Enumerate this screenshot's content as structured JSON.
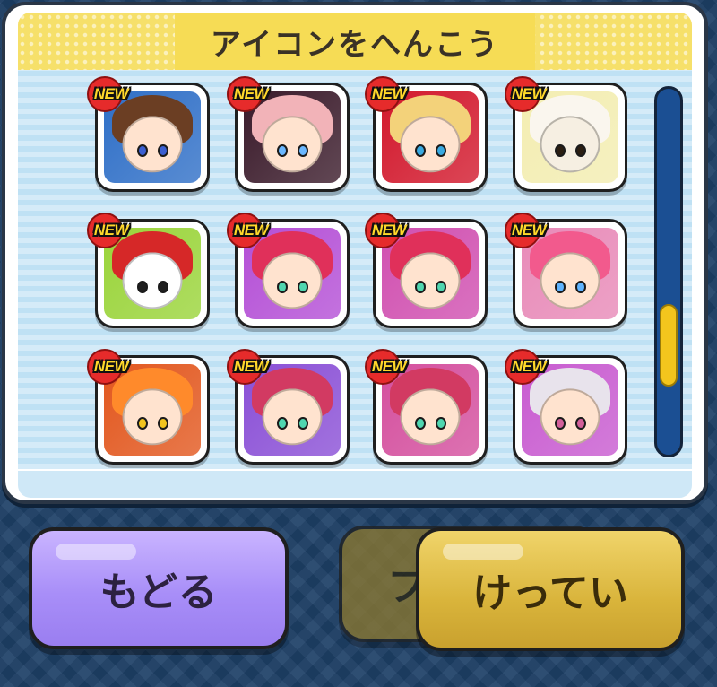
{
  "dialog": {
    "title": "アイコンをへんこう"
  },
  "icons": [
    {
      "badge": "NEW",
      "bg": "#2f6fc7",
      "hair": "#6b3e23",
      "eye": "#3b5fd1",
      "icon": "character-icon"
    },
    {
      "badge": "NEW",
      "bg": "#3a1a2a",
      "hair": "#f2b3b8",
      "eye": "#6ab7ff",
      "icon": "character-icon"
    },
    {
      "badge": "NEW",
      "bg": "#d2182c",
      "hair": "#f3d27a",
      "eye": "#39a9e0",
      "icon": "character-icon"
    },
    {
      "badge": "NEW",
      "bg": "#f3edb1",
      "hair": "#faf6ee",
      "eye": "#2b1e12",
      "icon": "sheep-icon"
    },
    {
      "badge": "NEW",
      "bg": "#9ad43a",
      "hair": "#d62828",
      "eye": "#1f1f1f",
      "icon": "duck-icon"
    },
    {
      "badge": "NEW",
      "bg": "#b44fd6",
      "hair": "#e0305a",
      "eye": "#4fd6b0",
      "icon": "character-icon"
    },
    {
      "badge": "NEW",
      "bg": "#d04fb0",
      "hair": "#e0305a",
      "eye": "#4fd6b0",
      "icon": "character-icon"
    },
    {
      "badge": "NEW",
      "bg": "#e88ab8",
      "hair": "#f25a8d",
      "eye": "#5fb4ff",
      "icon": "character-icon"
    },
    {
      "badge": "NEW",
      "bg": "#e2571e",
      "hair": "#ff8a2b",
      "eye": "#f2c41e",
      "icon": "character-icon"
    },
    {
      "badge": "NEW",
      "bg": "#8a4fd6",
      "hair": "#d23a62",
      "eye": "#4fd6b0",
      "icon": "character-icon"
    },
    {
      "badge": "NEW",
      "bg": "#d44f9e",
      "hair": "#d23a62",
      "eye": "#4fd6b0",
      "icon": "character-icon"
    },
    {
      "badge": "NEW",
      "bg": "#c85bd0",
      "hair": "#e8e3ec",
      "eye": "#d25f9a",
      "icon": "character-icon"
    }
  ],
  "scrollbar": {
    "position": 0.75
  },
  "buttons": {
    "back_label": "もどる",
    "ghost_label": "フ",
    "confirm_label": "けってい"
  },
  "colors": {
    "badge_red": "#e62b2b",
    "badge_text": "#ffd82a",
    "back_button": "#a88ef8",
    "confirm_button": "#d9b43b",
    "scroll_thumb": "#f3c51d"
  }
}
